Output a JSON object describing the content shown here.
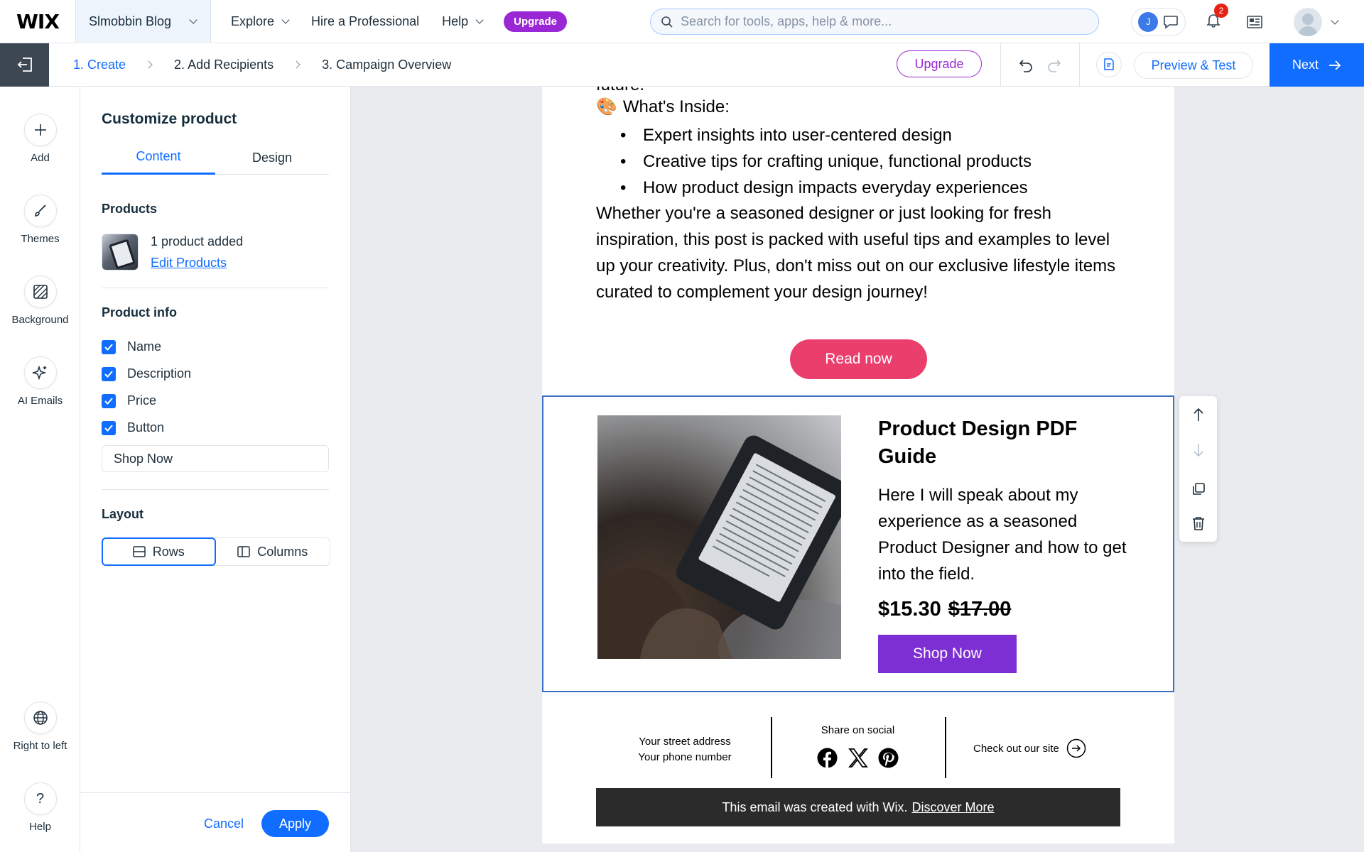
{
  "topbar": {
    "logo": "WIX",
    "site_name": "Slmobbin Blog",
    "menu": [
      "Explore",
      "Hire a Professional",
      "Help"
    ],
    "upgrade_label": "Upgrade",
    "search_placeholder": "Search for tools, apps, help & more...",
    "avatar_initial": "J",
    "notification_count": "2"
  },
  "stepbar": {
    "steps": [
      "1. Create",
      "2. Add Recipients",
      "3. Campaign Overview"
    ],
    "upgrade_label": "Upgrade",
    "preview_label": "Preview & Test",
    "next_label": "Next"
  },
  "rail": {
    "items": [
      "Add",
      "Themes",
      "Background",
      "AI Emails",
      "Right to left",
      "Help"
    ]
  },
  "panel": {
    "title": "Customize product",
    "tabs": [
      "Content",
      "Design"
    ],
    "products_label": "Products",
    "product_count": "1 product added",
    "edit_link": "Edit Products",
    "product_info_label": "Product info",
    "checkboxes": [
      "Name",
      "Description",
      "Price",
      "Button"
    ],
    "button_text_value": "Shop Now",
    "layout_label": "Layout",
    "layout_options": [
      "Rows",
      "Columns"
    ],
    "cancel_label": "Cancel",
    "apply_label": "Apply"
  },
  "email": {
    "cut_text": "future.",
    "inside_emoji": "🎨",
    "inside_heading": "What's Inside:",
    "bullets": [
      "Expert insights into user-centered design",
      "Creative tips for crafting unique, functional products",
      "How product design impacts everyday experiences"
    ],
    "paragraph": "Whether you're a seasoned designer or just looking for fresh inspiration, this post is packed with useful tips and examples to level up your creativity. Plus, don't miss out on our exclusive lifestyle items curated to complement your design journey!",
    "read_button": "Read now",
    "product": {
      "title": "Product Design PDF Guide",
      "description": "Here I will speak about my experience as a seasoned Product Designer and how to get into the field.",
      "price": "$15.30",
      "old_price": "$17.00",
      "button": "Shop Now"
    },
    "footer": {
      "address_line1": "Your street address",
      "address_line2": "Your phone number",
      "share_label": "Share on social",
      "site_label": "Check out our site"
    },
    "banner_text": "This email was created with Wix.",
    "banner_link": "Discover More"
  },
  "colors": {
    "accent_blue": "#116dff",
    "upgrade_purple": "#9a27d5",
    "read_pink": "#ea3e6d",
    "shop_purple": "#7d2fd3"
  }
}
